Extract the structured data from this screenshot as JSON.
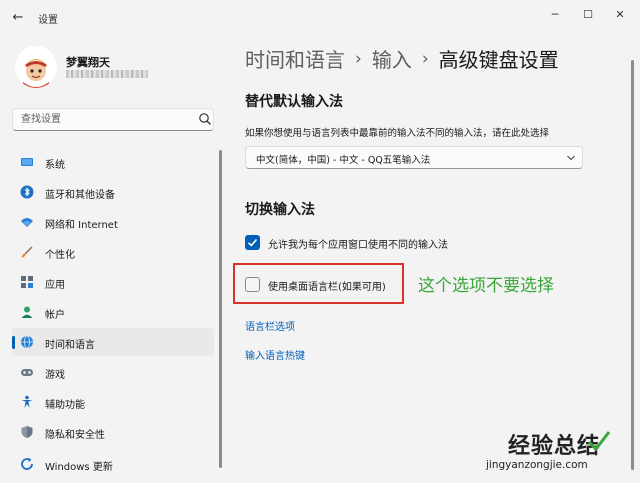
{
  "app": {
    "title": "设置",
    "back_glyph": "←"
  },
  "window_controls": {
    "minimize": "─",
    "maximize": "☐",
    "close": "✕"
  },
  "user": {
    "name": "梦翼翔天"
  },
  "search": {
    "placeholder": "查找设置"
  },
  "nav": {
    "items": [
      {
        "label": "系统",
        "icon": "monitor-icon"
      },
      {
        "label": "蓝牙和其他设备",
        "icon": "bluetooth-icon"
      },
      {
        "label": "网络和 Internet",
        "icon": "wifi-icon"
      },
      {
        "label": "个性化",
        "icon": "brush-icon"
      },
      {
        "label": "应用",
        "icon": "apps-icon"
      },
      {
        "label": "帐户",
        "icon": "person-icon"
      },
      {
        "label": "时间和语言",
        "icon": "globe-clock-icon",
        "active": true
      },
      {
        "label": "游戏",
        "icon": "gamepad-icon"
      },
      {
        "label": "辅助功能",
        "icon": "accessibility-icon"
      },
      {
        "label": "隐私和安全性",
        "icon": "shield-icon"
      },
      {
        "label": "Windows 更新",
        "icon": "update-icon"
      }
    ]
  },
  "breadcrumb": {
    "level1": "时间和语言",
    "level2": "输入",
    "current": "高级键盘设置",
    "separator": "›"
  },
  "override": {
    "title": "替代默认输入法",
    "description": "如果你想使用与语言列表中最靠前的输入法不同的输入法，请在此处选择",
    "selected": "中文(简体，中国) - 中文 - QQ五笔输入法"
  },
  "switching": {
    "title": "切换输入法",
    "per_app_label": "允许我为每个应用窗口使用不同的输入法",
    "per_app_checked": true,
    "language_bar_label": "使用桌面语言栏(如果可用)",
    "language_bar_checked": false
  },
  "annotation": {
    "text": "这个选项不要选择",
    "color": "#3aa63a"
  },
  "links": {
    "language_bar_options": "语言栏选项",
    "hotkeys": "输入语言热键"
  },
  "watermark": {
    "main": "经验总结",
    "url": "jingyanzongjie.com"
  },
  "colors": {
    "accent": "#005fb8",
    "highlight": "#d9322b"
  }
}
